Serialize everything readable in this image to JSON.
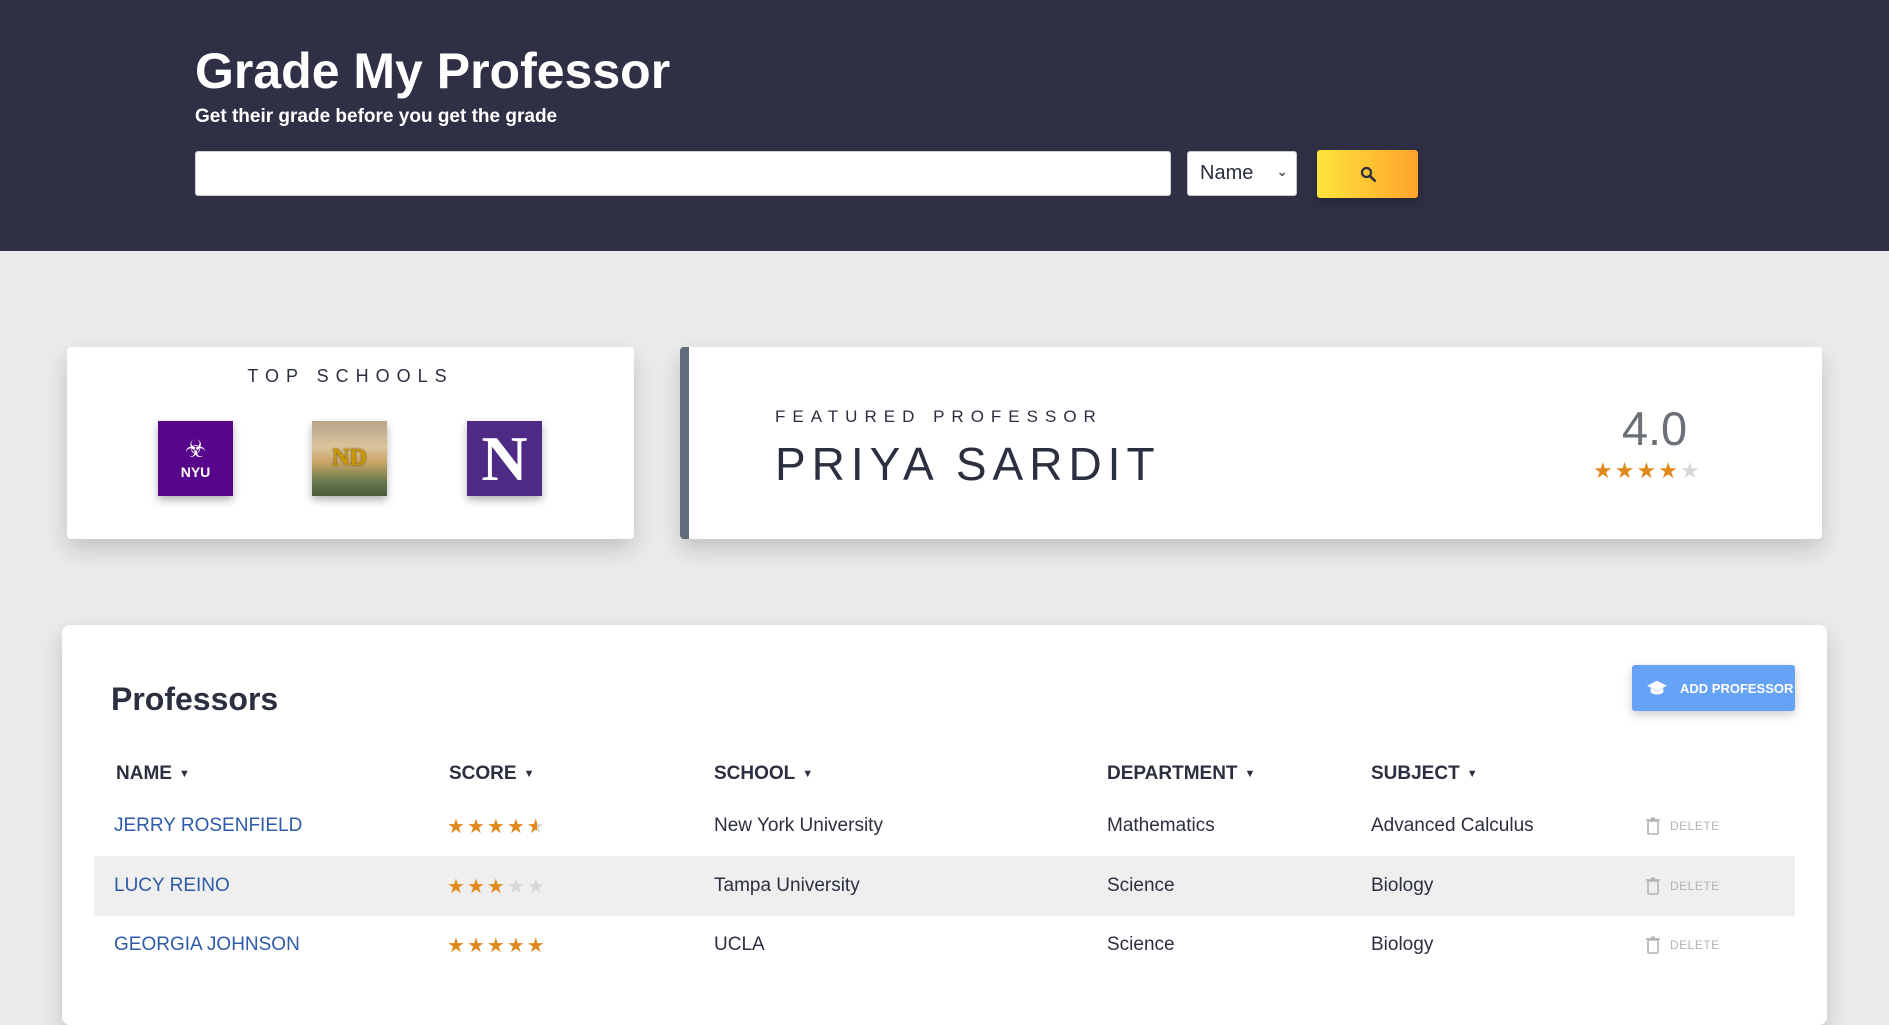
{
  "header": {
    "title": "Grade My Professor",
    "subtitle": "Get their grade before you get the grade",
    "search_value": "",
    "search_filter": "Name",
    "search_icon": "magnifier-icon",
    "accent_gradient": [
      "#fbe53b",
      "#ffa32b"
    ],
    "background": "#2f3045"
  },
  "top_schools": {
    "title": "TOP SCHOOLS",
    "schools": [
      {
        "logo_text": "NYU",
        "color": "#57068c"
      },
      {
        "logo_text": "ND",
        "color": "#c99700"
      },
      {
        "logo_text": "N",
        "color": "#4e2a84"
      }
    ]
  },
  "featured": {
    "kicker": "FEATURED PROFESSOR",
    "name": "PRIYA SARDIT",
    "score": "4.0",
    "stars": 4
  },
  "professors": {
    "title": "Professors",
    "add_label": "ADD PROFESSOR",
    "add_icon": "graduation-cap-icon",
    "columns": [
      "NAME",
      "SCORE",
      "SCHOOL",
      "DEPARTMENT",
      "SUBJECT"
    ],
    "delete_label": "DELETE",
    "rows": [
      {
        "name": "JERRY ROSENFIELD",
        "stars": 4.5,
        "school": "New York University",
        "department": "Mathematics",
        "subject": "Advanced Calculus"
      },
      {
        "name": "LUCY REINO",
        "stars": 3,
        "school": "Tampa University",
        "department": "Science",
        "subject": "Biology"
      },
      {
        "name": "GEORGIA JOHNSON",
        "stars": 5,
        "school": "UCLA",
        "department": "Science",
        "subject": "Biology"
      }
    ]
  },
  "colors": {
    "link": "#2e5aa8",
    "star": "#e08a1e",
    "star_empty": "#d8d8d8",
    "add_button": "#66a2f5"
  }
}
